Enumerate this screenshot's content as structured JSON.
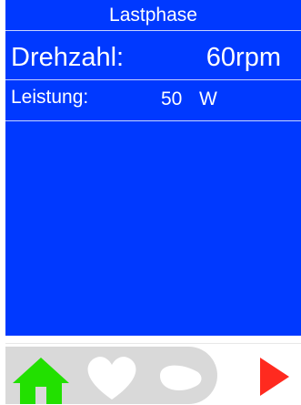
{
  "screen": {
    "title": "Lastphase",
    "speed_label": "Drehzahl:",
    "speed_value": "60rpm",
    "power_label": "Leistung:",
    "power_value": "50",
    "power_unit": "W"
  },
  "nav": {
    "buttons": [
      {
        "name": "home-icon",
        "color": "#22e000"
      },
      {
        "name": "heart-icon",
        "color": "#ffffff"
      },
      {
        "name": "drop-icon",
        "color": "#ffffff"
      },
      {
        "name": "play-icon",
        "color": "#ff2a1f"
      }
    ]
  },
  "colors": {
    "screen_bg": "#0039ff",
    "text": "#ffffff",
    "nav_bg": "#d9d9d9"
  }
}
